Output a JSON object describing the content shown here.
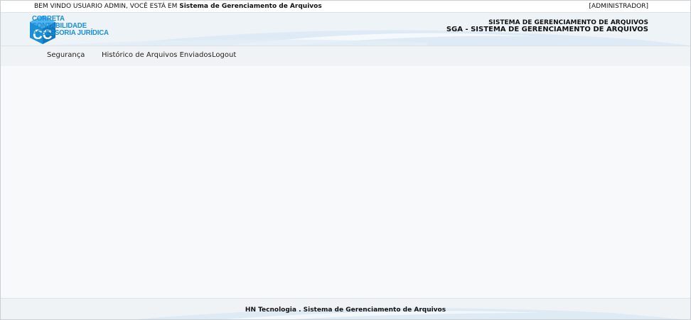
{
  "topbar": {
    "welcome_prefix": "BEM VINDO USUARIO ADMIN, VOCÊ ESTÁ EM ",
    "welcome_system": "Sistema de Gerenciamento de Arquivos",
    "role": "[ADMINISTRADOR]"
  },
  "header": {
    "logo": {
      "letters": "CC",
      "line1": "CORRETA",
      "line2": "CONTABILIDADE",
      "line3": "ASSESSORIA JURÍDICA"
    },
    "system_title": "SISTEMA DE GERENCIAMENTO DE ARQUIVOS",
    "system_subtitle": "SGA - SISTEMA DE GERENCIAMENTO DE ARQUIVOS"
  },
  "menu": {
    "items": [
      {
        "label": "Segurança"
      },
      {
        "label": "Histórico de Arquivos Enviados"
      },
      {
        "label": "Logout"
      }
    ]
  },
  "footer": {
    "text": "HN Tecnologia . Sistema de Gerenciamento de Arquivos"
  },
  "colors": {
    "brand_blue": "#1b8fd6",
    "header_bg": "#eef3f7",
    "page_bg": "#f8f9fa"
  }
}
